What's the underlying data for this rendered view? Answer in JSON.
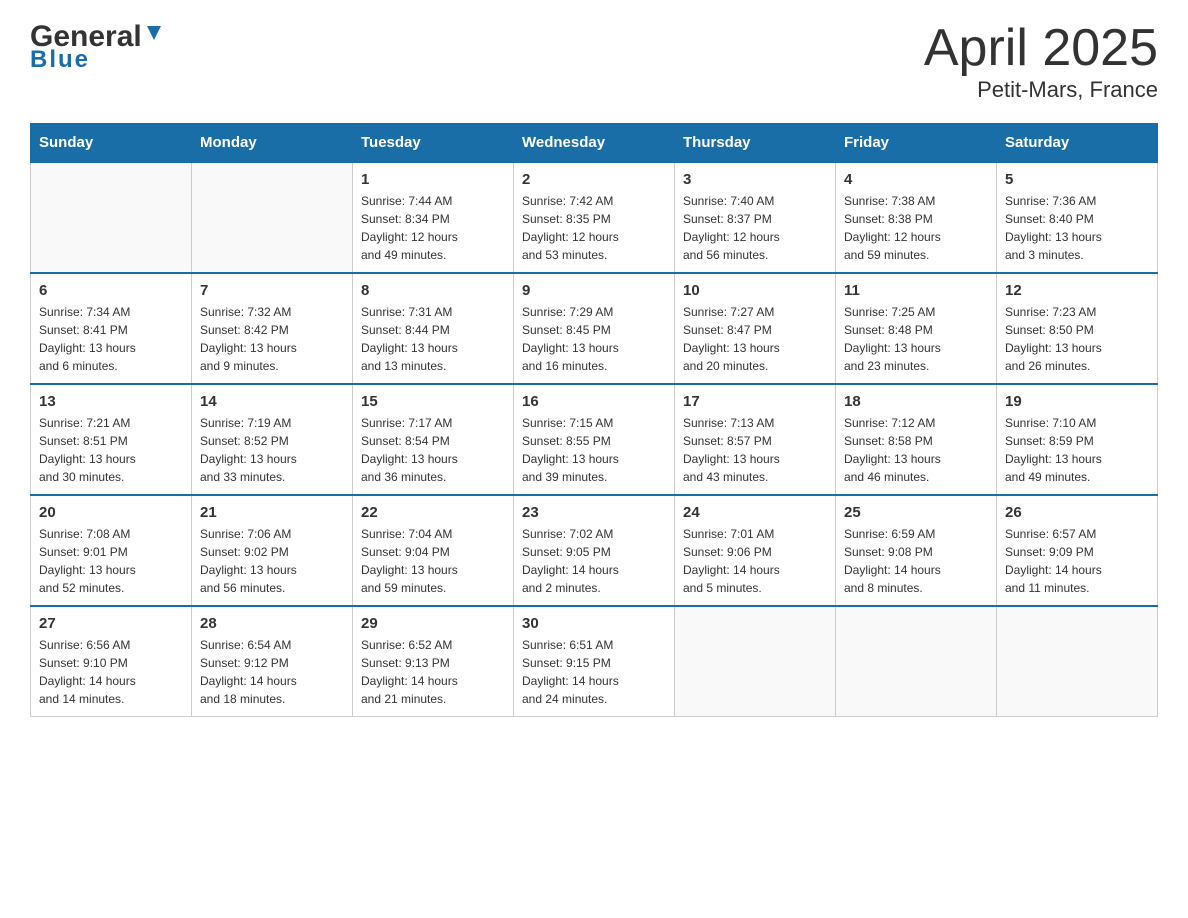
{
  "logo": {
    "word1": "General",
    "word2": "Blue"
  },
  "header": {
    "title": "April 2025",
    "location": "Petit-Mars, France"
  },
  "weekdays": [
    "Sunday",
    "Monday",
    "Tuesday",
    "Wednesday",
    "Thursday",
    "Friday",
    "Saturday"
  ],
  "weeks": [
    [
      {
        "day": "",
        "info": ""
      },
      {
        "day": "",
        "info": ""
      },
      {
        "day": "1",
        "info": "Sunrise: 7:44 AM\nSunset: 8:34 PM\nDaylight: 12 hours\nand 49 minutes."
      },
      {
        "day": "2",
        "info": "Sunrise: 7:42 AM\nSunset: 8:35 PM\nDaylight: 12 hours\nand 53 minutes."
      },
      {
        "day": "3",
        "info": "Sunrise: 7:40 AM\nSunset: 8:37 PM\nDaylight: 12 hours\nand 56 minutes."
      },
      {
        "day": "4",
        "info": "Sunrise: 7:38 AM\nSunset: 8:38 PM\nDaylight: 12 hours\nand 59 minutes."
      },
      {
        "day": "5",
        "info": "Sunrise: 7:36 AM\nSunset: 8:40 PM\nDaylight: 13 hours\nand 3 minutes."
      }
    ],
    [
      {
        "day": "6",
        "info": "Sunrise: 7:34 AM\nSunset: 8:41 PM\nDaylight: 13 hours\nand 6 minutes."
      },
      {
        "day": "7",
        "info": "Sunrise: 7:32 AM\nSunset: 8:42 PM\nDaylight: 13 hours\nand 9 minutes."
      },
      {
        "day": "8",
        "info": "Sunrise: 7:31 AM\nSunset: 8:44 PM\nDaylight: 13 hours\nand 13 minutes."
      },
      {
        "day": "9",
        "info": "Sunrise: 7:29 AM\nSunset: 8:45 PM\nDaylight: 13 hours\nand 16 minutes."
      },
      {
        "day": "10",
        "info": "Sunrise: 7:27 AM\nSunset: 8:47 PM\nDaylight: 13 hours\nand 20 minutes."
      },
      {
        "day": "11",
        "info": "Sunrise: 7:25 AM\nSunset: 8:48 PM\nDaylight: 13 hours\nand 23 minutes."
      },
      {
        "day": "12",
        "info": "Sunrise: 7:23 AM\nSunset: 8:50 PM\nDaylight: 13 hours\nand 26 minutes."
      }
    ],
    [
      {
        "day": "13",
        "info": "Sunrise: 7:21 AM\nSunset: 8:51 PM\nDaylight: 13 hours\nand 30 minutes."
      },
      {
        "day": "14",
        "info": "Sunrise: 7:19 AM\nSunset: 8:52 PM\nDaylight: 13 hours\nand 33 minutes."
      },
      {
        "day": "15",
        "info": "Sunrise: 7:17 AM\nSunset: 8:54 PM\nDaylight: 13 hours\nand 36 minutes."
      },
      {
        "day": "16",
        "info": "Sunrise: 7:15 AM\nSunset: 8:55 PM\nDaylight: 13 hours\nand 39 minutes."
      },
      {
        "day": "17",
        "info": "Sunrise: 7:13 AM\nSunset: 8:57 PM\nDaylight: 13 hours\nand 43 minutes."
      },
      {
        "day": "18",
        "info": "Sunrise: 7:12 AM\nSunset: 8:58 PM\nDaylight: 13 hours\nand 46 minutes."
      },
      {
        "day": "19",
        "info": "Sunrise: 7:10 AM\nSunset: 8:59 PM\nDaylight: 13 hours\nand 49 minutes."
      }
    ],
    [
      {
        "day": "20",
        "info": "Sunrise: 7:08 AM\nSunset: 9:01 PM\nDaylight: 13 hours\nand 52 minutes."
      },
      {
        "day": "21",
        "info": "Sunrise: 7:06 AM\nSunset: 9:02 PM\nDaylight: 13 hours\nand 56 minutes."
      },
      {
        "day": "22",
        "info": "Sunrise: 7:04 AM\nSunset: 9:04 PM\nDaylight: 13 hours\nand 59 minutes."
      },
      {
        "day": "23",
        "info": "Sunrise: 7:02 AM\nSunset: 9:05 PM\nDaylight: 14 hours\nand 2 minutes."
      },
      {
        "day": "24",
        "info": "Sunrise: 7:01 AM\nSunset: 9:06 PM\nDaylight: 14 hours\nand 5 minutes."
      },
      {
        "day": "25",
        "info": "Sunrise: 6:59 AM\nSunset: 9:08 PM\nDaylight: 14 hours\nand 8 minutes."
      },
      {
        "day": "26",
        "info": "Sunrise: 6:57 AM\nSunset: 9:09 PM\nDaylight: 14 hours\nand 11 minutes."
      }
    ],
    [
      {
        "day": "27",
        "info": "Sunrise: 6:56 AM\nSunset: 9:10 PM\nDaylight: 14 hours\nand 14 minutes."
      },
      {
        "day": "28",
        "info": "Sunrise: 6:54 AM\nSunset: 9:12 PM\nDaylight: 14 hours\nand 18 minutes."
      },
      {
        "day": "29",
        "info": "Sunrise: 6:52 AM\nSunset: 9:13 PM\nDaylight: 14 hours\nand 21 minutes."
      },
      {
        "day": "30",
        "info": "Sunrise: 6:51 AM\nSunset: 9:15 PM\nDaylight: 14 hours\nand 24 minutes."
      },
      {
        "day": "",
        "info": ""
      },
      {
        "day": "",
        "info": ""
      },
      {
        "day": "",
        "info": ""
      }
    ]
  ]
}
